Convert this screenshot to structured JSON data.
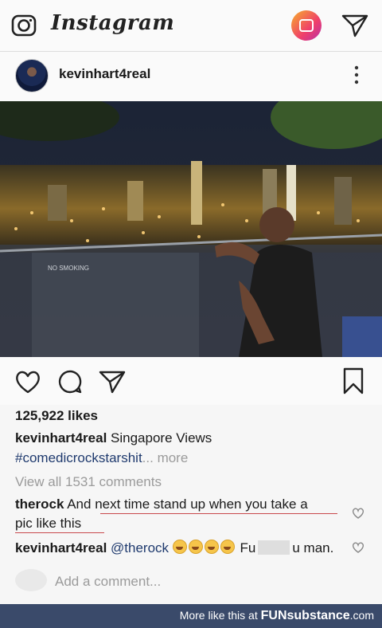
{
  "app": {
    "name": "Instagram"
  },
  "post": {
    "username": "kevinhart4real",
    "likes": "125,922 likes",
    "caption_user": "kevinhart4real",
    "caption_text": "Singapore Views",
    "hashtag": "#comedicrockstarshit",
    "more": "... more",
    "view_comments": "View all 1531 comments",
    "photo_sign": "NO SMOKING"
  },
  "comments": [
    {
      "user": "therock",
      "text_a": "And ",
      "text_b": "next time stand up when you take a",
      "text_c": "pic like this"
    },
    {
      "user": "kevinhart4real",
      "mention": "@therock",
      "text_a": "Fu",
      "text_b": "u man."
    }
  ],
  "add_comment": {
    "placeholder": "Add a comment..."
  },
  "footer": {
    "prefix": "More like this at ",
    "brand": "FUNsubstance",
    "suffix": ".com"
  },
  "icons": [
    "camera-icon",
    "igtv-icon",
    "send-icon",
    "more-icon",
    "heart-icon",
    "comment-icon",
    "share-icon",
    "bookmark-icon"
  ],
  "colors": {
    "igtv_gradient": "#ef3f6b",
    "hashtag": "#1f3a6e",
    "underline": "#c8494c",
    "footer_bg": "#3a4a6a"
  }
}
